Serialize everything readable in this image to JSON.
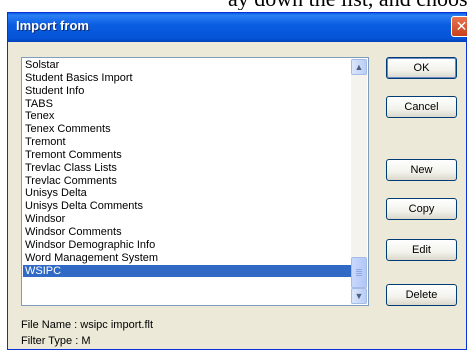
{
  "background_text": "ay down the list, and choose WSIPC",
  "dialog": {
    "title": "Import from",
    "close_glyph": "✕"
  },
  "list": {
    "items": [
      "Solstar",
      "Student Basics Import",
      "Student Info",
      "TABS",
      "Tenex",
      "Tenex Comments",
      "Tremont",
      "Tremont Comments",
      "Trevlac Class Lists",
      "Trevlac Comments",
      "Unisys Delta",
      "Unisys Delta Comments",
      "Windsor",
      "Windsor Comments",
      "Windsor Demographic Info",
      "Word Management System",
      "WSIPC"
    ],
    "selected": "WSIPC"
  },
  "buttons": {
    "ok": "OK",
    "cancel": "Cancel",
    "new": "New",
    "copy": "Copy",
    "edit": "Edit",
    "delete": "Delete"
  },
  "info": {
    "file_name": "File Name : wsipc import.flt",
    "filter_type": "Filter Type : M"
  },
  "colors": {
    "selection": "#316ac5",
    "titlebar": "#0553d7",
    "dialog_bg": "#ece9d8"
  }
}
